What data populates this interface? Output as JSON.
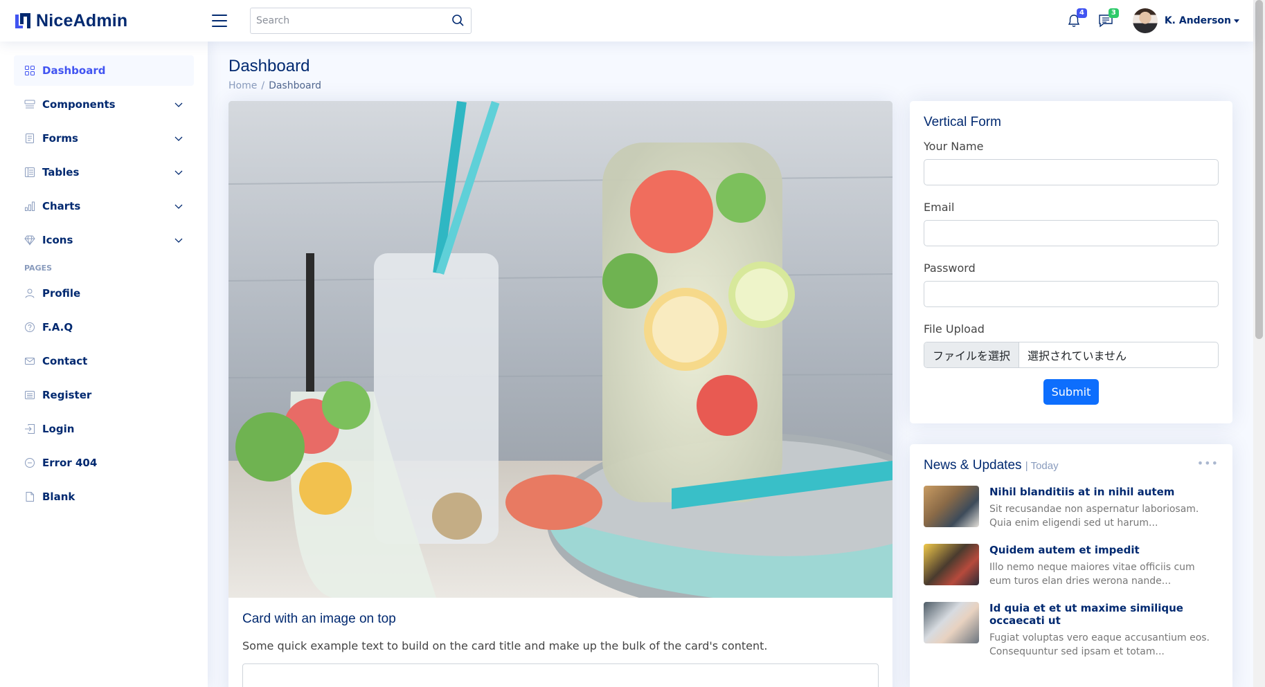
{
  "brand": {
    "name": "NiceAdmin"
  },
  "header": {
    "search_placeholder": "Search",
    "notifications_count": "4",
    "messages_count": "3",
    "profile_name": "K. Anderson"
  },
  "sidebar": {
    "items": [
      {
        "label": "Dashboard",
        "icon": "grid-icon"
      },
      {
        "label": "Components",
        "icon": "menu-button-icon"
      },
      {
        "label": "Forms",
        "icon": "journal-text-icon"
      },
      {
        "label": "Tables",
        "icon": "layout-text-icon"
      },
      {
        "label": "Charts",
        "icon": "bar-chart-icon"
      },
      {
        "label": "Icons",
        "icon": "gem-icon"
      }
    ],
    "pages_heading": "Pages",
    "pages": [
      {
        "label": "Profile",
        "icon": "person-icon"
      },
      {
        "label": "F.A.Q",
        "icon": "question-circle-icon"
      },
      {
        "label": "Contact",
        "icon": "envelope-icon"
      },
      {
        "label": "Register",
        "icon": "card-list-icon"
      },
      {
        "label": "Login",
        "icon": "box-arrow-in-right-icon"
      },
      {
        "label": "Error 404",
        "icon": "dash-circle-icon"
      },
      {
        "label": "Blank",
        "icon": "file-icon"
      }
    ]
  },
  "page": {
    "title": "Dashboard",
    "breadcrumb": {
      "home": "Home",
      "current": "Dashboard"
    }
  },
  "image_card": {
    "title": "Card with an image on top",
    "text": "Some quick example text to build on the card title and make up the bulk of the card's content."
  },
  "form": {
    "title": "Vertical Form",
    "name_label": "Your Name",
    "email_label": "Email",
    "password_label": "Password",
    "file_label": "File Upload",
    "file_button": "ファイルを選択",
    "file_status": "選択されていません",
    "submit": "Submit"
  },
  "news": {
    "title": "News & Updates",
    "subtitle": "| Today",
    "items": [
      {
        "title": "Nihil blanditiis at in nihil autem",
        "text": "Sit recusandae non aspernatur laboriosam. Quia enim eligendi sed ut harum..."
      },
      {
        "title": "Quidem autem et impedit",
        "text": "Illo nemo neque maiores vitae officiis cum eum turos elan dries werona nande..."
      },
      {
        "title": "Id quia et et ut maxime similique occaecati ut",
        "text": "Fugiat voluptas vero eaque accusantium eos. Consequuntur sed ipsam et totam..."
      }
    ]
  },
  "colors": {
    "primary": "#4154f1",
    "navy": "#012970",
    "submit": "#0d6efd",
    "badge_blue": "#4154f1",
    "badge_green": "#2eca6a"
  }
}
